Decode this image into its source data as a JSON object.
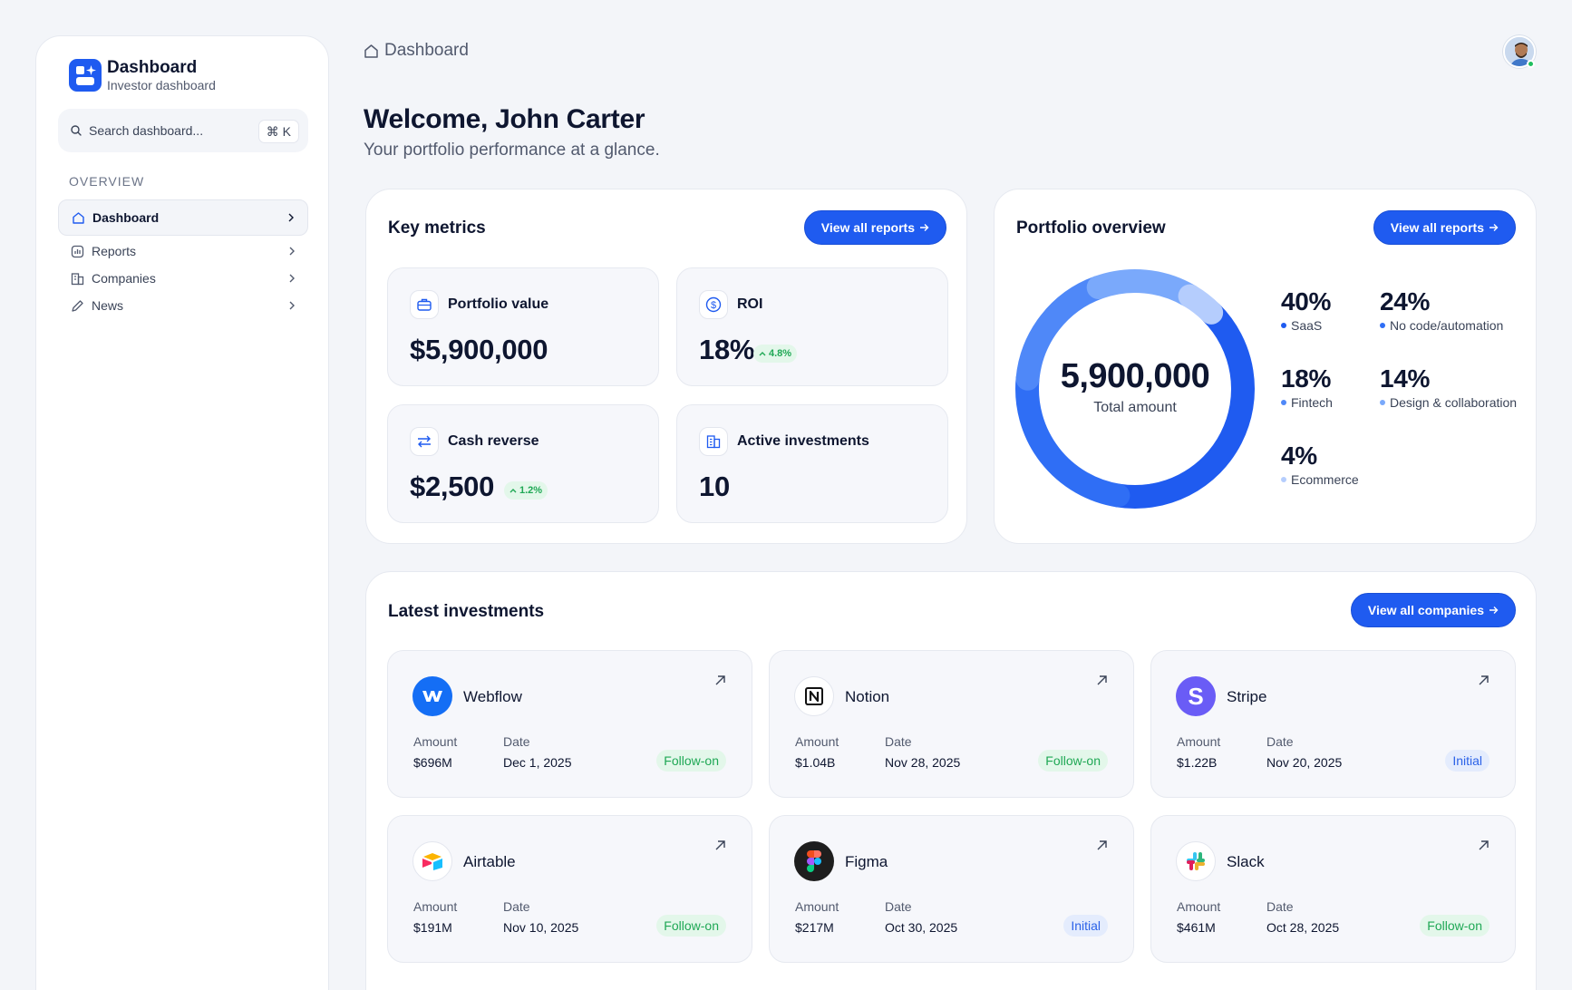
{
  "sidebar": {
    "brand_title": "Dashboard",
    "brand_subtitle": "Investor dashboard",
    "search_placeholder": "Search dashboard...",
    "search_shortcut": "⌘ K",
    "section_label": "OVERVIEW",
    "items": [
      {
        "label": "Dashboard",
        "icon": "home-icon",
        "active": true
      },
      {
        "label": "Reports",
        "icon": "bar-chart-icon",
        "active": false
      },
      {
        "label": "Companies",
        "icon": "building-icon",
        "active": false
      },
      {
        "label": "News",
        "icon": "pencil-icon",
        "active": false
      }
    ]
  },
  "header": {
    "breadcrumb": "Dashboard",
    "welcome": "Welcome, John Carter",
    "tagline": "Your portfolio performance at a glance."
  },
  "key_metrics": {
    "title": "Key metrics",
    "button": "View all reports",
    "items": [
      {
        "label": "Portfolio value",
        "value": "$5,900,000",
        "icon": "briefcase-icon"
      },
      {
        "label": "ROI",
        "value": "18%",
        "change": "4.8%",
        "icon": "dollar-circle-icon"
      },
      {
        "label": "Cash reverse",
        "value": "$2,500",
        "change": "1.2%",
        "icon": "arrows-swap-icon"
      },
      {
        "label": "Active investments",
        "value": "10",
        "icon": "building-icon"
      }
    ]
  },
  "portfolio": {
    "title": "Portfolio overview",
    "button": "View all reports",
    "total_value": "5,900,000",
    "total_label": "Total amount",
    "segments": [
      {
        "pct": "40%",
        "label": "SaaS",
        "value": 40,
        "color": "#1f5bf0"
      },
      {
        "pct": "24%",
        "label": "No code/automation",
        "value": 24,
        "color": "#2f6ef5"
      },
      {
        "pct": "18%",
        "label": "Fintech",
        "value": 18,
        "color": "#4f88f8"
      },
      {
        "pct": "14%",
        "label": "Design & collaboration",
        "value": 14,
        "color": "#7aa9fb"
      },
      {
        "pct": "4%",
        "label": "Ecommerce",
        "value": 4,
        "color": "#b5cdfd"
      }
    ]
  },
  "investments": {
    "title": "Latest investments",
    "button": "View all companies",
    "amount_label": "Amount",
    "date_label": "Date",
    "items": [
      {
        "name": "Webflow",
        "amount": "$696M",
        "date": "Dec 1, 2025",
        "type": "Follow-on"
      },
      {
        "name": "Notion",
        "amount": "$1.04B",
        "date": "Nov 28, 2025",
        "type": "Follow-on"
      },
      {
        "name": "Stripe",
        "amount": "$1.22B",
        "date": "Nov 20, 2025",
        "type": "Initial"
      },
      {
        "name": "Airtable",
        "amount": "$191M",
        "date": "Nov 10, 2025",
        "type": "Follow-on"
      },
      {
        "name": "Figma",
        "amount": "$217M",
        "date": "Oct 30, 2025",
        "type": "Initial"
      },
      {
        "name": "Slack",
        "amount": "$461M",
        "date": "Oct 28, 2025",
        "type": "Follow-on"
      }
    ]
  }
}
